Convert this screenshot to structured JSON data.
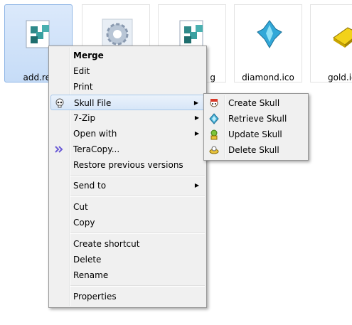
{
  "files": [
    {
      "name": "add.re",
      "selected": true
    },
    {
      "name": "",
      "selected": false
    },
    {
      "name": "g",
      "selected": false
    },
    {
      "name": "diamond.ico",
      "selected": false
    },
    {
      "name": "gold.ic",
      "selected": false
    }
  ],
  "context_menu": {
    "items": [
      {
        "label": "Merge"
      },
      {
        "label": "Edit"
      },
      {
        "label": "Print"
      },
      {
        "label": "Skull File"
      },
      {
        "label": "7-Zip"
      },
      {
        "label": "Open with"
      },
      {
        "label": "TeraCopy..."
      },
      {
        "label": "Restore previous versions"
      },
      {
        "label": "Send to"
      },
      {
        "label": "Cut"
      },
      {
        "label": "Copy"
      },
      {
        "label": "Create shortcut"
      },
      {
        "label": "Delete"
      },
      {
        "label": "Rename"
      },
      {
        "label": "Properties"
      }
    ]
  },
  "submenu": {
    "items": [
      {
        "label": "Create Skull"
      },
      {
        "label": "Retrieve Skull"
      },
      {
        "label": "Update Skull"
      },
      {
        "label": "Delete Skull"
      }
    ]
  },
  "colors": {
    "selection": "#c6dcf7",
    "menu_bg": "#f0f0f0",
    "hover": "#d7e6f8"
  }
}
